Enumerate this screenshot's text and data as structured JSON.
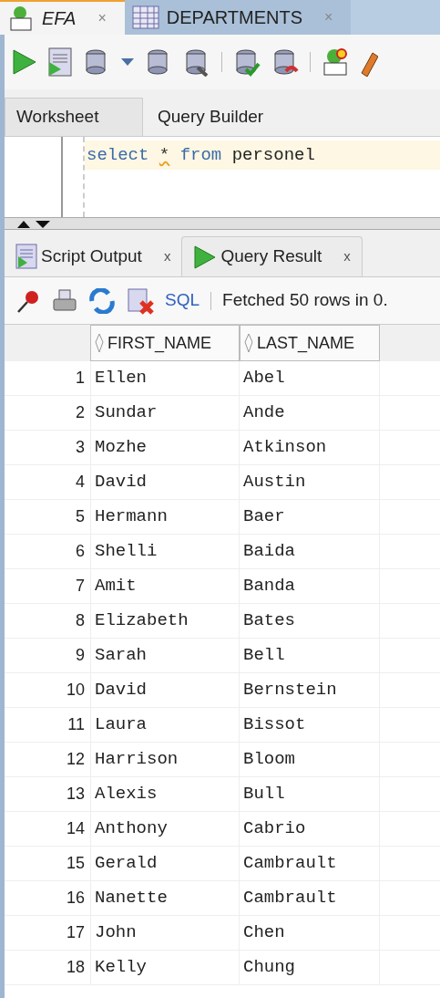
{
  "editor_tabs": [
    {
      "label": "EFA",
      "selected": true,
      "close": "×"
    },
    {
      "label": "DEPARTMENTS",
      "selected": false,
      "close": "×"
    }
  ],
  "sub_tabs": [
    {
      "label": "Worksheet",
      "selected": true
    },
    {
      "label": "Query Builder",
      "selected": false
    }
  ],
  "sql": {
    "keyword1": "select",
    "star": "*",
    "keyword2": "from",
    "table": "personel"
  },
  "result_tabs": [
    {
      "label": "Script Output",
      "selected": false,
      "close": "x"
    },
    {
      "label": "Query Result",
      "selected": true,
      "close": "x"
    }
  ],
  "result_toolbar": {
    "sql_link": "SQL",
    "status": "Fetched 50 rows in 0."
  },
  "table": {
    "columns": [
      "",
      "FIRST_NAME",
      "LAST_NAME"
    ],
    "rows": [
      [
        "1",
        "Ellen",
        "Abel"
      ],
      [
        "2",
        "Sundar",
        "Ande"
      ],
      [
        "3",
        "Mozhe",
        "Atkinson"
      ],
      [
        "4",
        "David",
        "Austin"
      ],
      [
        "5",
        "Hermann",
        "Baer"
      ],
      [
        "6",
        "Shelli",
        "Baida"
      ],
      [
        "7",
        "Amit",
        "Banda"
      ],
      [
        "8",
        "Elizabeth",
        "Bates"
      ],
      [
        "9",
        "Sarah",
        "Bell"
      ],
      [
        "10",
        "David",
        "Bernstein"
      ],
      [
        "11",
        "Laura",
        "Bissot"
      ],
      [
        "12",
        "Harrison",
        "Bloom"
      ],
      [
        "13",
        "Alexis",
        "Bull"
      ],
      [
        "14",
        "Anthony",
        "Cabrio"
      ],
      [
        "15",
        "Gerald",
        "Cambrault"
      ],
      [
        "16",
        "Nanette",
        "Cambrault"
      ],
      [
        "17",
        "John",
        "Chen"
      ],
      [
        "18",
        "Kelly",
        "Chung"
      ]
    ]
  }
}
